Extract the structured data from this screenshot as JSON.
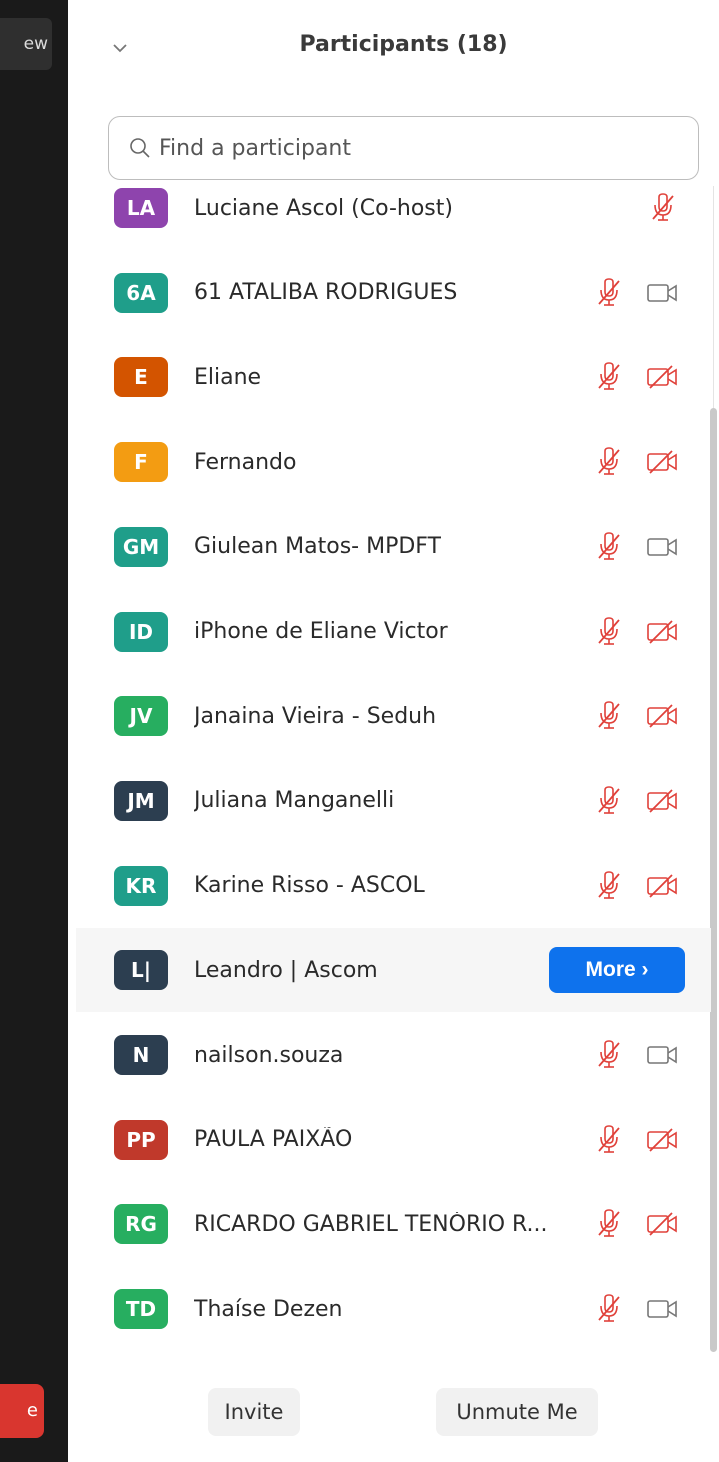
{
  "left_strip": {
    "view_label": "ew",
    "red_label": "e"
  },
  "header": {
    "title": "Participants (18)"
  },
  "search": {
    "placeholder": "Find a participant",
    "value": ""
  },
  "colors": {
    "accent": "#0e72ed",
    "muted_red": "#e0413a"
  },
  "participants": [
    {
      "initials": "LA",
      "name": "Luciane Ascol (Co-host)",
      "color": "#8e44ad",
      "mic": "muted",
      "video": "none"
    },
    {
      "initials": "6A",
      "name": "61 ATALIBA RODRIGUES",
      "color": "#1f9e8a",
      "mic": "muted",
      "video": "on"
    },
    {
      "initials": "E",
      "name": "Eliane",
      "color": "#d35400",
      "mic": "muted",
      "video": "off"
    },
    {
      "initials": "F",
      "name": "Fernando",
      "color": "#f39c12",
      "mic": "muted",
      "video": "off"
    },
    {
      "initials": "GM",
      "name": "Giulean Matos- MPDFT",
      "color": "#1f9e8a",
      "mic": "muted",
      "video": "on"
    },
    {
      "initials": "ID",
      "name": "iPhone de Eliane Victor",
      "color": "#1f9e8a",
      "mic": "muted",
      "video": "off"
    },
    {
      "initials": "JV",
      "name": "Janaina Vieira - Seduh",
      "color": "#27ae60",
      "mic": "muted",
      "video": "off"
    },
    {
      "initials": "JM",
      "name": "Juliana Manganelli",
      "color": "#2c3e50",
      "mic": "muted",
      "video": "off"
    },
    {
      "initials": "KR",
      "name": "Karine Risso - ASCOL",
      "color": "#1f9e8a",
      "mic": "muted",
      "video": "off"
    },
    {
      "initials": "L|",
      "name": "Leandro | Ascom",
      "color": "#2c3e50",
      "mic": "hidden",
      "video": "hidden",
      "more_label": "More ›"
    },
    {
      "initials": "N",
      "name": "nailson.souza",
      "color": "#2c3e50",
      "mic": "muted",
      "video": "on"
    },
    {
      "initials": "PP",
      "name": "PAULA PAIXÃO",
      "color": "#c0392b",
      "mic": "muted",
      "video": "off"
    },
    {
      "initials": "RG",
      "name": "RICARDO GABRIEL TENÓRIO R...",
      "color": "#27ae60",
      "mic": "muted",
      "video": "off"
    },
    {
      "initials": "TD",
      "name": "Thaíse Dezen",
      "color": "#27ae60",
      "mic": "muted",
      "video": "on"
    }
  ],
  "footer": {
    "invite_label": "Invite",
    "unmute_label": "Unmute Me"
  }
}
